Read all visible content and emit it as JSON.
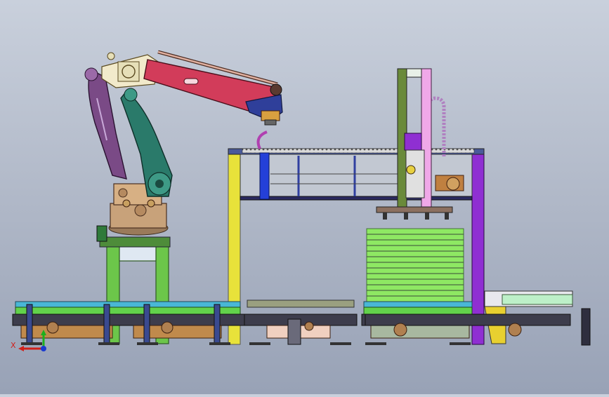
{
  "scene": {
    "axis_triad": {
      "x_label": "X"
    },
    "colors": {
      "background_top": "#c9d0dc",
      "background_bottom": "#98a2b6",
      "robot_base": "#c8a27a",
      "robot_upper_arm": "#2a7a6a",
      "robot_forearm": "#d23c5a",
      "robot_rear_link": "#7a4a86",
      "robot_wrist": "#2f3f9a",
      "stand": "#6cc64a",
      "gantry_yellow": "#e8e23a",
      "gantry_purple": "#8f2fd2",
      "gantry_blue": "#2440d8",
      "vertical_column": "#6a8a3a",
      "vertical_column_panel": "#f0a8e8",
      "pallet_stack": "#7fe04f",
      "conveyor_rail": "#49b7d6",
      "conveyor_rollers": "#62d24b"
    },
    "icons": [
      "axis-triad-icon",
      "gear-icon",
      "roller-icon"
    ]
  }
}
